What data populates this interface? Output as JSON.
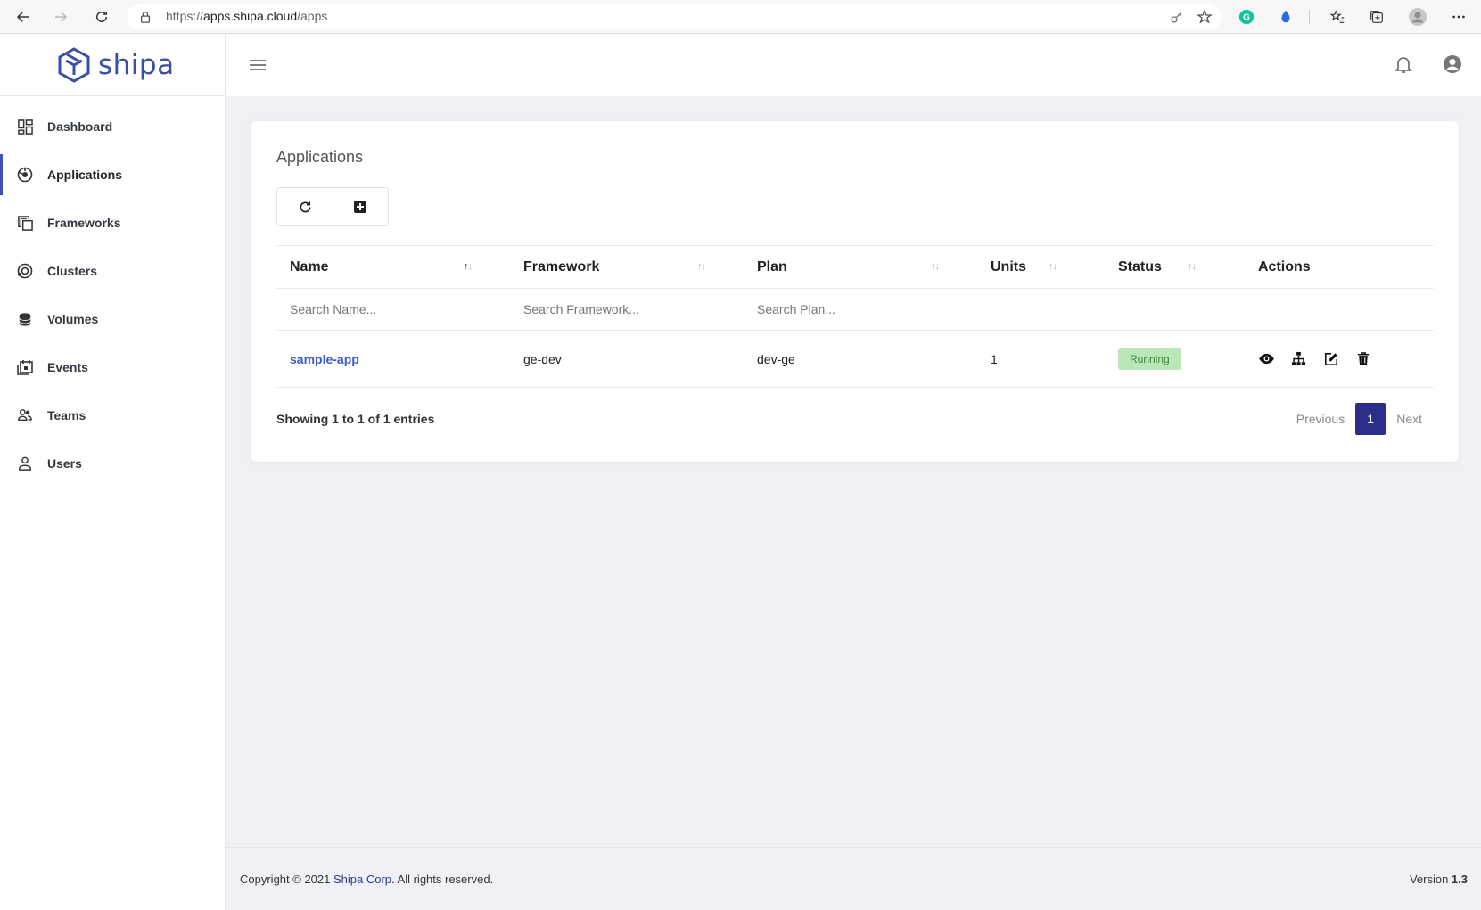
{
  "browser": {
    "url_prefix": "https://",
    "url_host": "apps.shipa.cloud",
    "url_path": "/apps"
  },
  "logo": {
    "text": "shipa"
  },
  "sidebar": {
    "items": [
      {
        "label": "Dashboard",
        "icon": "dashboard-icon"
      },
      {
        "label": "Applications",
        "icon": "applications-icon",
        "active": true
      },
      {
        "label": "Frameworks",
        "icon": "frameworks-icon"
      },
      {
        "label": "Clusters",
        "icon": "clusters-icon"
      },
      {
        "label": "Volumes",
        "icon": "volumes-icon"
      },
      {
        "label": "Events",
        "icon": "events-icon"
      },
      {
        "label": "Teams",
        "icon": "teams-icon"
      },
      {
        "label": "Users",
        "icon": "users-icon"
      }
    ]
  },
  "card": {
    "title": "Applications"
  },
  "table": {
    "columns": [
      "Name",
      "Framework",
      "Plan",
      "Units",
      "Status",
      "Actions"
    ],
    "search": {
      "name_placeholder": "Search Name...",
      "framework_placeholder": "Search Framework...",
      "plan_placeholder": "Search Plan..."
    },
    "rows": [
      {
        "name": "sample-app",
        "framework": "ge-dev",
        "plan": "dev-ge",
        "units": "1",
        "status": "Running"
      }
    ]
  },
  "footer_info": {
    "showing": "Showing 1 to 1 of 1 entries",
    "previous": "Previous",
    "page": "1",
    "next": "Next"
  },
  "footer": {
    "copyright_prefix": "Copyright © 2021 ",
    "company": "Shipa Corp",
    "copyright_suffix": ". All rights reserved.",
    "version_label": "Version ",
    "version": "1.3"
  },
  "colors": {
    "accent": "#3f51b5",
    "link": "#3a5ccc",
    "status_running_bg": "#b9e7b7",
    "status_running_text": "#3b8a3b",
    "pagination_active": "#2b2f8a"
  }
}
